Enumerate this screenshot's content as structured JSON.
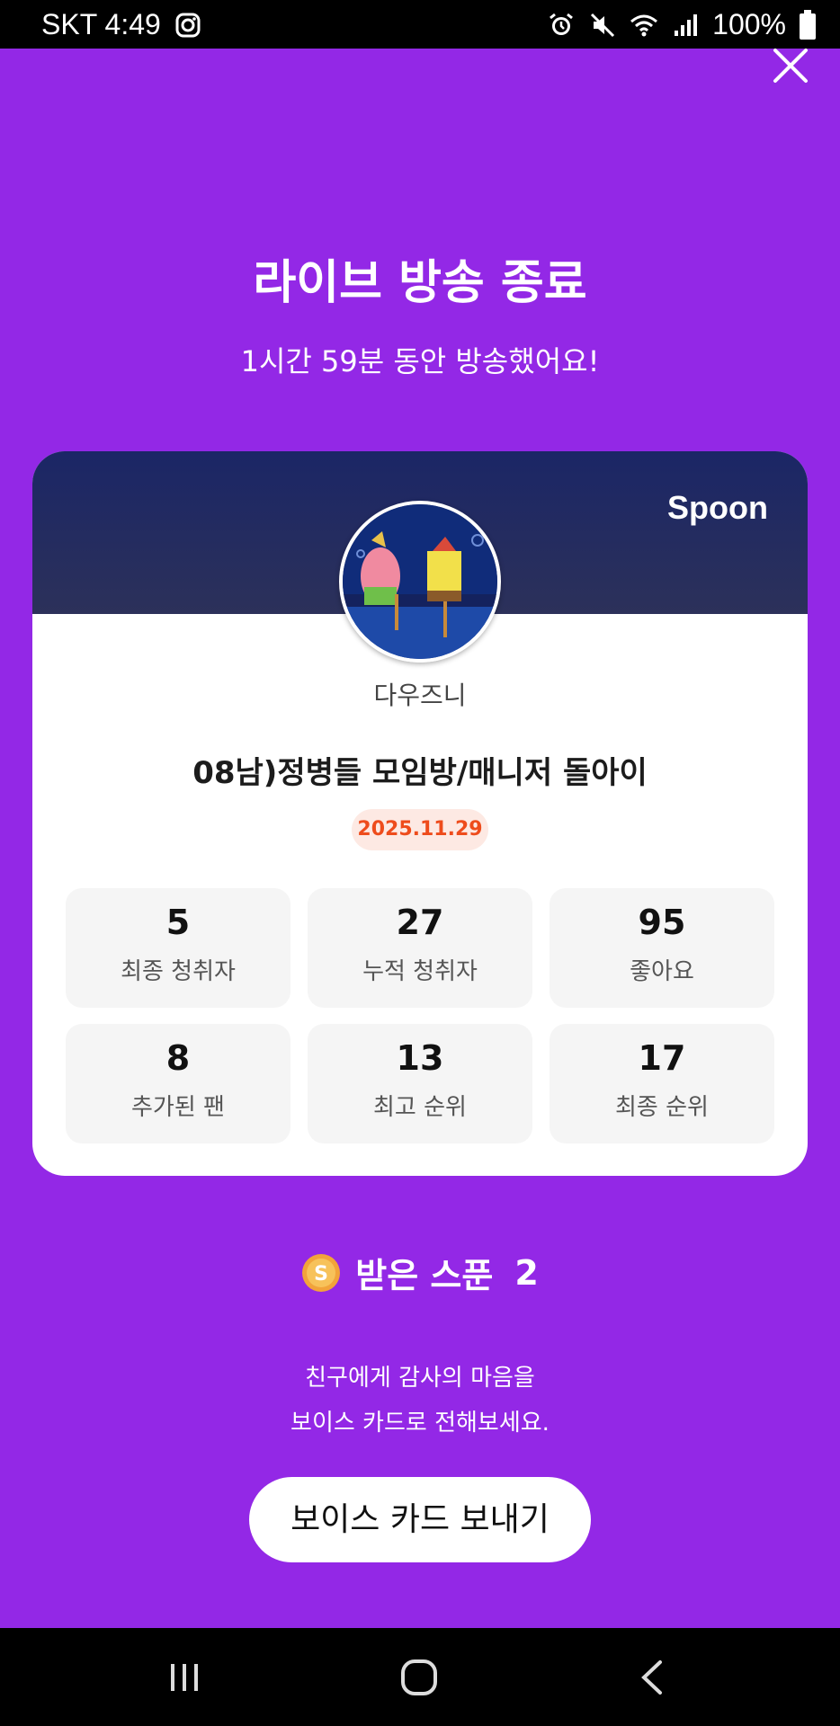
{
  "status_bar": {
    "carrier_time": "SKT 4:49",
    "battery": "100%"
  },
  "header": {
    "title": "라이브 방송 종료",
    "subtitle": "1시간 59분 동안 방송했어요!"
  },
  "card": {
    "brand": "Spoon",
    "nickname": "다우즈니",
    "room_title": "08남)정병들 모임방/매니저 돌아이",
    "date": "2025.11.29",
    "stats": [
      {
        "value": "5",
        "label": "최종 청취자"
      },
      {
        "value": "27",
        "label": "누적 청취자"
      },
      {
        "value": "95",
        "label": "좋아요"
      },
      {
        "value": "8",
        "label": "추가된 팬"
      },
      {
        "value": "13",
        "label": "최고 순위"
      },
      {
        "value": "17",
        "label": "최종 순위"
      }
    ]
  },
  "spoons": {
    "label": "받은 스푼",
    "count": "2",
    "coin_letter": "S"
  },
  "message": {
    "line1": "친구에게 감사의 마음을",
    "line2": "보이스 카드로 전해보세요."
  },
  "cta": {
    "label": "보이스 카드 보내기"
  },
  "colors": {
    "background": "#9328e6",
    "date_badge_text": "#ee4c1c",
    "date_badge_bg": "#fde9e3",
    "banner": "#1b2666"
  }
}
